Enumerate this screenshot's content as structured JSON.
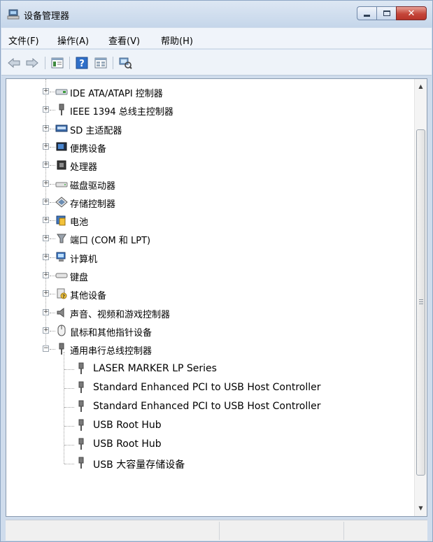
{
  "window": {
    "title": "设备管理器",
    "icon": "device-manager-icon",
    "controls": [
      "minimize-icon",
      "maximize-icon",
      "close-icon"
    ]
  },
  "menu": [
    "文件(F)",
    "操作(A)",
    "查看(V)",
    "帮助(H)"
  ],
  "toolbar": [
    "back-arrow-icon",
    "forward-arrow-icon",
    "properties-icon",
    "help-icon",
    "view-icon",
    "scan-hardware-icon"
  ],
  "tree": {
    "categories": [
      {
        "label": "IDE ATA/ATAPI 控制器",
        "icon": "ide-controller-icon",
        "expanded": false
      },
      {
        "label": "IEEE 1394 总线主控制器",
        "icon": "ieee1394-icon",
        "expanded": false
      },
      {
        "label": "SD 主适配器",
        "icon": "sd-card-icon",
        "expanded": false
      },
      {
        "label": "便携设备",
        "icon": "portable-device-icon",
        "expanded": false
      },
      {
        "label": "处理器",
        "icon": "processor-icon",
        "expanded": false
      },
      {
        "label": "磁盘驱动器",
        "icon": "disk-drive-icon",
        "expanded": false
      },
      {
        "label": "存储控制器",
        "icon": "storage-controller-icon",
        "expanded": false
      },
      {
        "label": "电池",
        "icon": "battery-icon",
        "expanded": false
      },
      {
        "label": "端口 (COM 和 LPT)",
        "icon": "port-icon",
        "expanded": false
      },
      {
        "label": "计算机",
        "icon": "computer-icon",
        "expanded": false
      },
      {
        "label": "键盘",
        "icon": "keyboard-icon",
        "expanded": false
      },
      {
        "label": "其他设备",
        "icon": "other-device-icon",
        "expanded": false
      },
      {
        "label": "声音、视频和游戏控制器",
        "icon": "speaker-icon",
        "expanded": false
      },
      {
        "label": "鼠标和其他指针设备",
        "icon": "mouse-icon",
        "expanded": false
      },
      {
        "label": "通用串行总线控制器",
        "icon": "usb-icon",
        "expanded": true
      }
    ],
    "usb_children": [
      "LASER MARKER LP Series",
      "Standard Enhanced PCI to USB Host Controller",
      "Standard Enhanced PCI to USB Host Controller",
      "USB Root Hub",
      "USB Root Hub",
      "USB 大容量存储设备"
    ],
    "expand_symbol": "+",
    "collapse_symbol": "−"
  },
  "scrollbar": {
    "up": "▲",
    "down": "▼"
  }
}
